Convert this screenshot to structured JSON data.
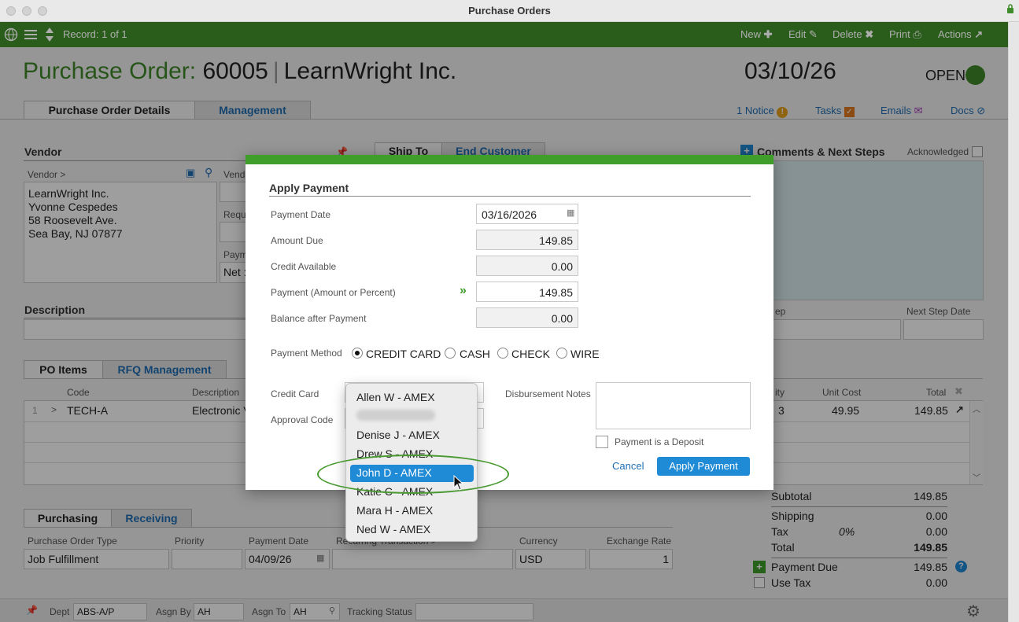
{
  "window": {
    "title": "Purchase Orders"
  },
  "toolbar": {
    "record": "Record: 1 of 1",
    "new": "New",
    "edit": "Edit",
    "delete": "Delete",
    "print": "Print",
    "actions": "Actions"
  },
  "header": {
    "label": "Purchase Order:",
    "number": "60005",
    "separator": "|",
    "vendor": "LearnWright Inc.",
    "date": "03/10/26",
    "status": "OPEN",
    "status_color": "#3f8a29"
  },
  "tabs": [
    "Purchase Order Details",
    "Management"
  ],
  "topnav": {
    "notice": "1 Notice",
    "tasks": "Tasks",
    "emails": "Emails",
    "docs": "Docs"
  },
  "vendor": {
    "heading": "Vendor",
    "field_label": "Vendor >",
    "lines": [
      "LearnWright Inc.",
      "Yvonne Cespedes",
      "58 Roosevelt Ave.",
      "Sea Bay, NJ 07877"
    ],
    "partial_labels": [
      "Vend",
      "Requ",
      "Paym"
    ],
    "partial_value": "Net :"
  },
  "ship_tabs": [
    "Ship To",
    "End Customer"
  ],
  "comments": {
    "heading": "Comments & Next Steps",
    "acknowledged": "Acknowledged",
    "step": "ep",
    "next_step_date": "Next Step Date"
  },
  "description": {
    "heading": "Description"
  },
  "items_tabs": [
    "PO Items",
    "RFQ Management"
  ],
  "items": {
    "headers": {
      "code": "Code",
      "description": "Description",
      "qty": "ity",
      "unit_cost": "Unit Cost",
      "total": "Total"
    },
    "row": {
      "index": "1",
      "arrow": ">",
      "code": "TECH-A",
      "description": "Electronic V",
      "qty": "3",
      "unit_cost": "49.95",
      "total": "149.85"
    }
  },
  "totals": {
    "subtotal_label": "Subtotal",
    "subtotal": "149.85",
    "shipping_label": "Shipping",
    "shipping": "0.00",
    "tax_label": "Tax",
    "tax_pct": "0%",
    "tax": "0.00",
    "total_label": "Total",
    "total": "149.85",
    "payment_due_label": "Payment Due",
    "payment_due": "149.85",
    "use_tax_label": "Use Tax",
    "use_tax": "0.00"
  },
  "purchasing_tabs": [
    "Purchasing",
    "Receiving"
  ],
  "purchasing": {
    "type_label": "Purchase Order Type",
    "type": "Job Fulfillment",
    "priority_label": "Priority",
    "priority": "",
    "payment_date_label": "Payment Date",
    "payment_date": "04/09/26",
    "recurring_label": "Recurring Transaction >",
    "currency_label": "Currency",
    "currency": "USD",
    "exchange_label": "Exchange Rate",
    "exchange": "1"
  },
  "footer": {
    "dept_label": "Dept",
    "dept": "ABS-A/P",
    "asgn_by_label": "Asgn By",
    "asgn_by": "AH",
    "asgn_to_label": "Asgn To",
    "asgn_to": "AH",
    "tracking_label": "Tracking Status",
    "tracking": ""
  },
  "modal": {
    "title": "Apply Payment",
    "payment_date_label": "Payment Date",
    "payment_date": "03/16/2026",
    "amount_due_label": "Amount Due",
    "amount_due": "149.85",
    "credit_available_label": "Credit Available",
    "credit_available": "0.00",
    "payment_label": "Payment (Amount or Percent)",
    "payment": "149.85",
    "balance_label": "Balance after Payment",
    "balance": "0.00",
    "method_label": "Payment Method",
    "methods": [
      "CREDIT CARD",
      "CASH",
      "CHECK",
      "WIRE"
    ],
    "selected_method": "CREDIT CARD",
    "credit_card_label": "Credit Card",
    "approval_label": "Approval Code",
    "notes_label": "Disbursement Notes",
    "deposit_label": "Payment is a Deposit",
    "cancel": "Cancel",
    "apply": "Apply Payment"
  },
  "dropdown": {
    "options": [
      "Allen W - AMEX",
      "",
      "Denise J - AMEX",
      "Drew S - AMEX",
      "John D - AMEX",
      "Katie C - AMEX",
      "Mara H - AMEX",
      "Ned W - AMEX"
    ],
    "highlighted": "John D - AMEX"
  }
}
